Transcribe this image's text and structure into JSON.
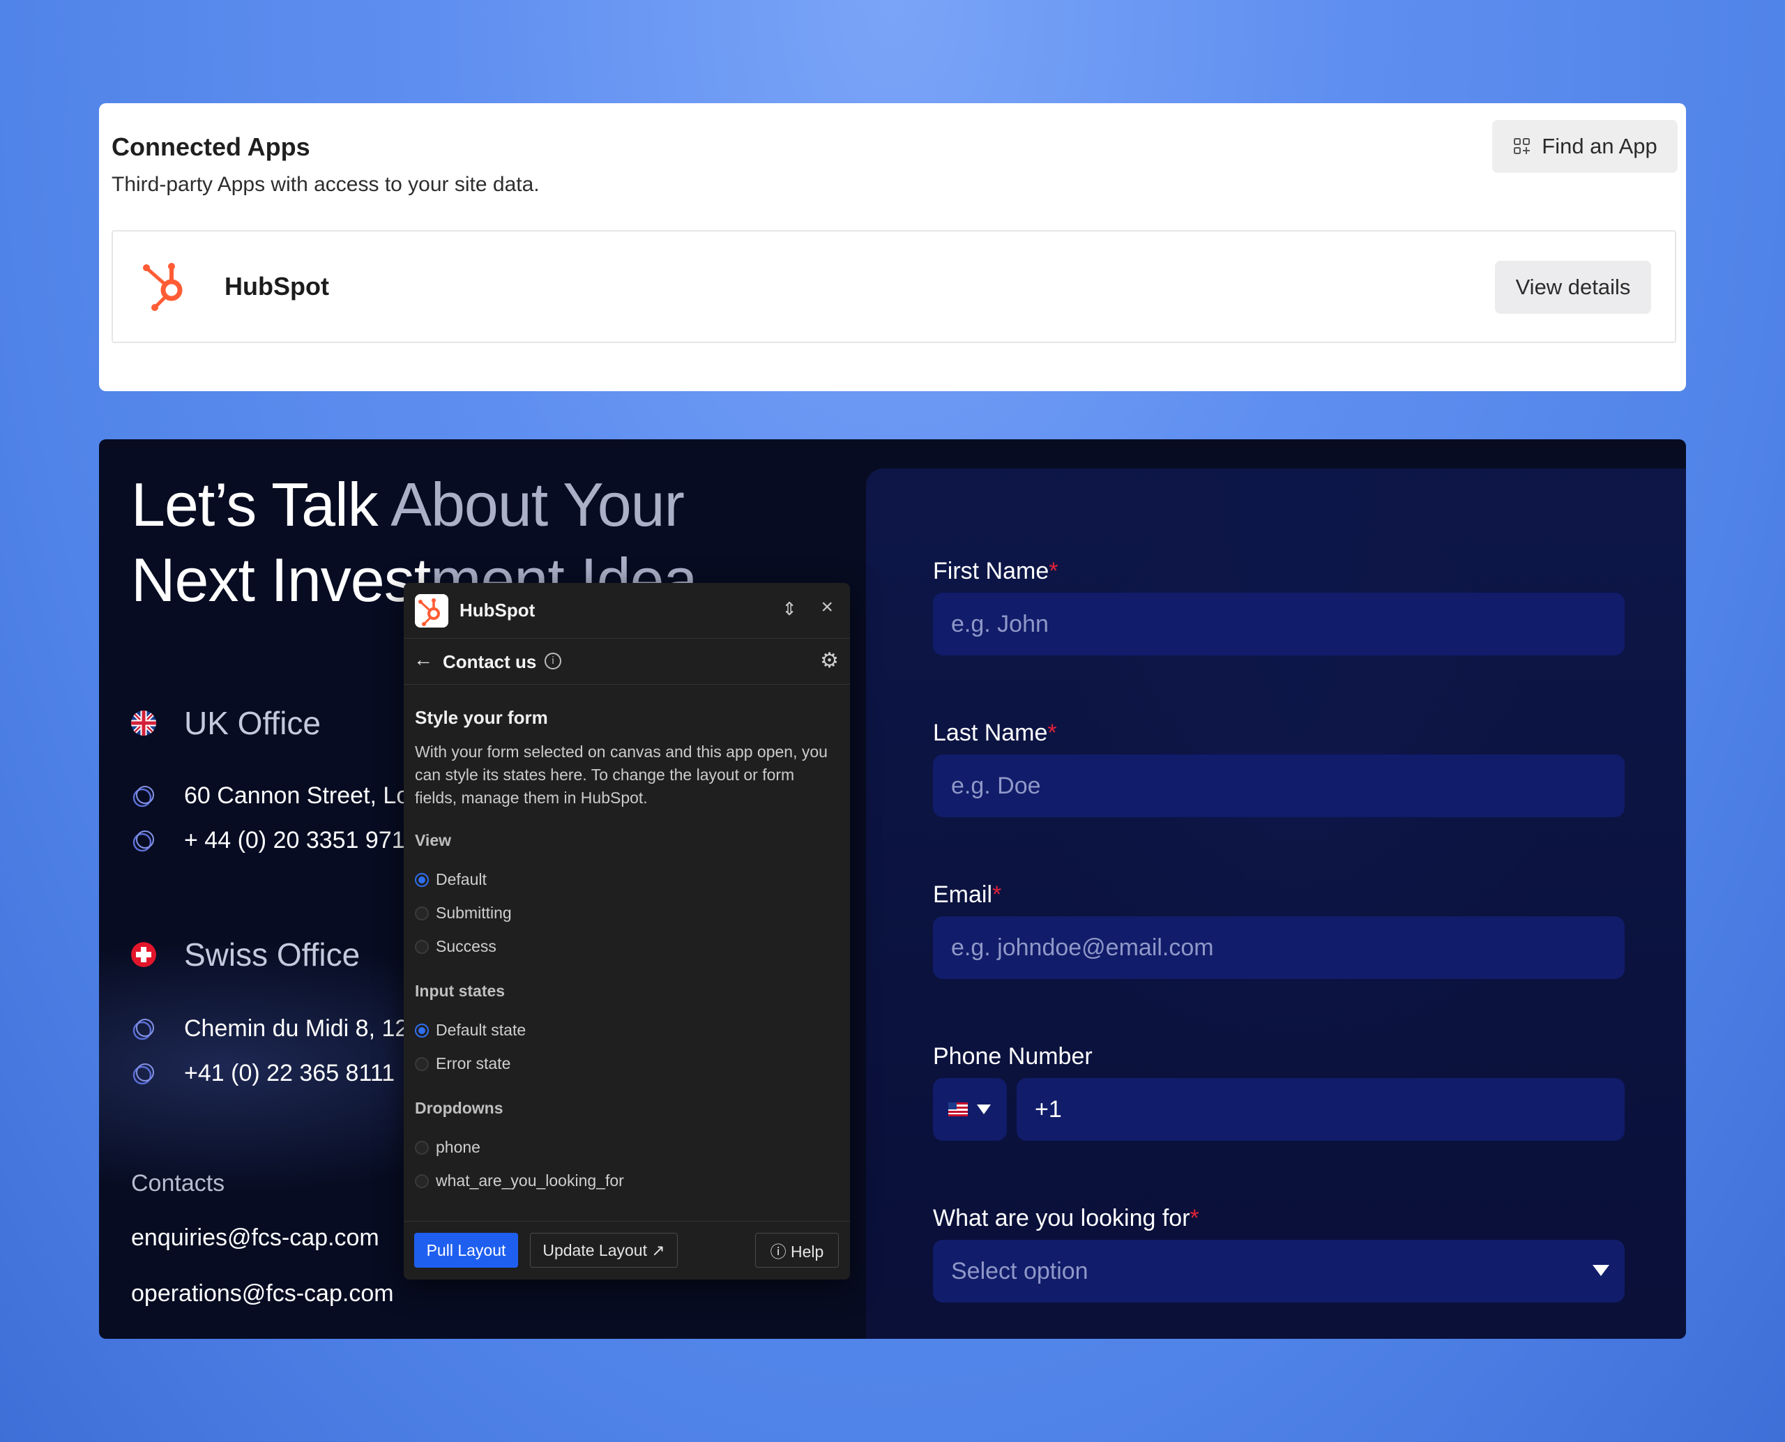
{
  "apps": {
    "title": "Connected Apps",
    "subtitle": "Third-party Apps with access to your site data.",
    "find_app_label": "Find an App",
    "app_name": "HubSpot",
    "view_details_label": "View details",
    "brand_color": "#ff5c35"
  },
  "site": {
    "headline_bright_1": "Let’s Talk",
    "headline_dim_1": "About Your",
    "headline_bright_2": "Next Invest",
    "headline_dim_2": "ment Idea",
    "uk_office": "UK Office",
    "uk_address": "60 Cannon Street, Lo",
    "uk_phone": "+ 44 (0) 20 3351 9717",
    "swiss_office": "Swiss Office",
    "swiss_address": "Chemin du Midi 8, 126",
    "swiss_phone": "+41 (0) 22 365 8111",
    "contacts_label": "Contacts",
    "email_1": "enquiries@fcs-cap.com",
    "email_2": "operations@fcs-cap.com"
  },
  "form": {
    "first_name_label": "First Name",
    "first_name_placeholder": "e.g. John",
    "last_name_label": "Last Name",
    "last_name_placeholder": "e.g. Doe",
    "email_label": "Email",
    "email_placeholder": "e.g. johndoe@email.com",
    "phone_label": "Phone Number",
    "phone_value": "+1",
    "looking_label": "What are you looking for",
    "looking_placeholder": "Select option",
    "required_mark": "*"
  },
  "hubspot_panel": {
    "title": "HubSpot",
    "subtitle": "Contact us",
    "section_title": "Style your form",
    "description": "With your form selected on canvas and this app open, you can style its states here. To change the layout or form fields, manage them in HubSpot.",
    "view_group": "View",
    "view_options": [
      "Default",
      "Submitting",
      "Success"
    ],
    "input_group": "Input states",
    "input_options": [
      "Default state",
      "Error state"
    ],
    "dropdown_group": "Dropdowns",
    "dropdown_options": [
      "phone",
      "what_are_you_looking_for"
    ],
    "pull_layout": "Pull Layout",
    "update_layout": "Update Layout ↗",
    "help": "Help"
  }
}
